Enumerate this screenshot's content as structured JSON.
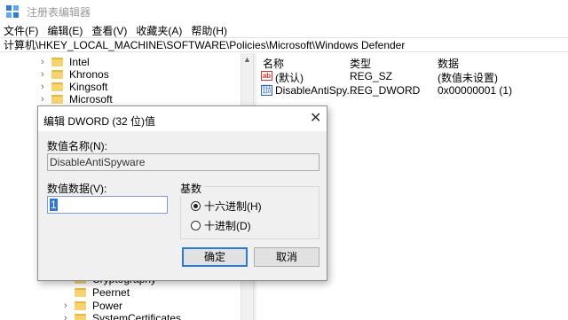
{
  "window": {
    "title": "注册表编辑器"
  },
  "menu": [
    "文件(F)",
    "编辑(E)",
    "查看(V)",
    "收藏夹(A)",
    "帮助(H)"
  ],
  "address": "计算机\\HKEY_LOCAL_MACHINE\\SOFTWARE\\Policies\\Microsoft\\Windows Defender",
  "tree": {
    "top_items": [
      "Intel",
      "Khronos",
      "Kingsoft",
      "Microsoft"
    ],
    "bottom_items": [
      "Cryptography",
      "Peernet",
      "Power",
      "SystemCertificates"
    ]
  },
  "list": {
    "columns": {
      "name": "名称",
      "type": "类型",
      "data": "数据"
    },
    "rows": [
      {
        "name": "(默认)",
        "type": "REG_SZ",
        "data": "(数值未设置)",
        "icon": "string-value-icon"
      },
      {
        "name": "DisableAntiSpy...",
        "type": "REG_DWORD",
        "data": "0x00000001 (1)",
        "icon": "binary-value-icon"
      }
    ]
  },
  "dialog": {
    "title": "编辑 DWORD (32 位)值",
    "name_label": "数值名称(N):",
    "name_value": "DisableAntiSpyware",
    "data_label": "数值数据(V):",
    "data_value": "1",
    "base_label": "基数",
    "hex_label": "十六进制(H)",
    "dec_label": "十进制(D)",
    "selected_base": "hex",
    "ok_label": "确定",
    "cancel_label": "取消"
  }
}
